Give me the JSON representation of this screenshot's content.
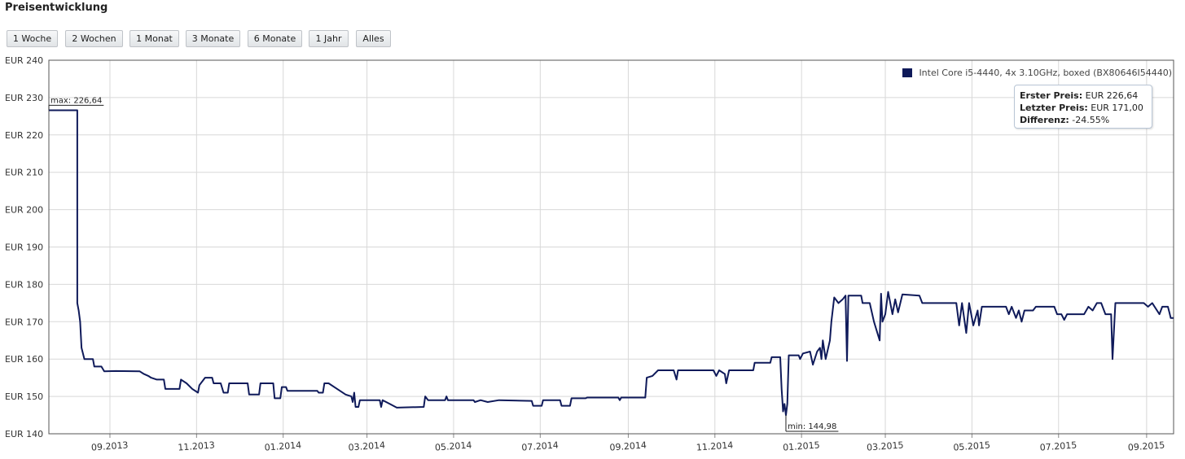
{
  "title": "Preisentwicklung",
  "range_buttons": [
    "1 Woche",
    "2 Wochen",
    "1 Monat",
    "3 Monate",
    "6 Monate",
    "1 Jahr",
    "Alles"
  ],
  "legend": {
    "label": "Intel Core i5-4440, 4x 3.10GHz, boxed (BX80646I54440)",
    "color": "#0f1a5a"
  },
  "stats": {
    "first_label": "Erster Preis:",
    "first_value": "EUR 226,64",
    "last_label": "Letzter Preis:",
    "last_value": "EUR 171,00",
    "diff_label": "Differenz:",
    "diff_value": "-24.55%"
  },
  "chart_data": {
    "type": "line",
    "x_start": "2013-07-20",
    "x_end": "2015-09-20",
    "ylim": [
      140,
      240
    ],
    "y_ticks": [
      140,
      150,
      160,
      170,
      180,
      190,
      200,
      210,
      220,
      230,
      240
    ],
    "y_tick_prefix": "EUR",
    "x_ticks": [
      "09.2013",
      "11.2013",
      "01.2014",
      "03.2014",
      "05.2014",
      "07.2014",
      "09.2014",
      "11.2014",
      "01.2015",
      "03.2015",
      "05.2015",
      "07.2015",
      "09.2015"
    ],
    "grid": true,
    "legend_position": "top-right",
    "annotations": [
      {
        "text": "max: 226,64",
        "x": "2013-07-20",
        "y": 226.64
      },
      {
        "text": "min: 144,98",
        "x": "2014-12-21",
        "y": 144.98
      }
    ],
    "series": [
      {
        "name": "Intel Core i5-4440, 4x 3.10GHz, boxed (BX80646I54440)",
        "color": "#0f1a5a",
        "points": [
          [
            "2013-07-20",
            226.6
          ],
          [
            "2013-08-09",
            226.6
          ],
          [
            "2013-08-09",
            175
          ],
          [
            "2013-08-10",
            173
          ],
          [
            "2013-08-11",
            170
          ],
          [
            "2013-08-12",
            163
          ],
          [
            "2013-08-14",
            160
          ],
          [
            "2013-08-20",
            160
          ],
          [
            "2013-08-21",
            158
          ],
          [
            "2013-08-26",
            158
          ],
          [
            "2013-08-28",
            156.7
          ],
          [
            "2013-09-05",
            156.8
          ],
          [
            "2013-09-22",
            156.7
          ],
          [
            "2013-09-25",
            156
          ],
          [
            "2013-09-28",
            155.5
          ],
          [
            "2013-09-30",
            155
          ],
          [
            "2013-10-04",
            154.5
          ],
          [
            "2013-10-09",
            154.5
          ],
          [
            "2013-10-10",
            152
          ],
          [
            "2013-10-20",
            152
          ],
          [
            "2013-10-21",
            154.5
          ],
          [
            "2013-10-25",
            153.5
          ],
          [
            "2013-10-29",
            152
          ],
          [
            "2013-11-02",
            151
          ],
          [
            "2013-11-03",
            153
          ],
          [
            "2013-11-07",
            155
          ],
          [
            "2013-11-12",
            155
          ],
          [
            "2013-11-13",
            153.5
          ],
          [
            "2013-11-18",
            153.5
          ],
          [
            "2013-11-20",
            151
          ],
          [
            "2013-11-23",
            151
          ],
          [
            "2013-11-24",
            153.5
          ],
          [
            "2013-12-07",
            153.5
          ],
          [
            "2013-12-08",
            150.5
          ],
          [
            "2013-12-15",
            150.5
          ],
          [
            "2013-12-16",
            153.5
          ],
          [
            "2013-12-25",
            153.5
          ],
          [
            "2013-12-26",
            149.5
          ],
          [
            "2013-12-30",
            149.5
          ],
          [
            "2013-12-31",
            152.5
          ],
          [
            "2014-01-03",
            152.5
          ],
          [
            "2014-01-04",
            151.5
          ],
          [
            "2014-01-25",
            151.5
          ],
          [
            "2014-01-26",
            151
          ],
          [
            "2014-01-29",
            151
          ],
          [
            "2014-01-30",
            153.5
          ],
          [
            "2014-02-02",
            153.5
          ],
          [
            "2014-02-08",
            152
          ],
          [
            "2014-02-14",
            150.5
          ],
          [
            "2014-02-18",
            150
          ],
          [
            "2014-02-19",
            148.5
          ],
          [
            "2014-02-20",
            151
          ],
          [
            "2014-02-21",
            147.2
          ],
          [
            "2014-02-23",
            147.2
          ],
          [
            "2014-02-24",
            149
          ],
          [
            "2014-03-10",
            149
          ],
          [
            "2014-03-11",
            147.2
          ],
          [
            "2014-03-12",
            149
          ],
          [
            "2014-03-17",
            148
          ],
          [
            "2014-03-22",
            147
          ],
          [
            "2014-04-10",
            147.2
          ],
          [
            "2014-04-11",
            150
          ],
          [
            "2014-04-13",
            149
          ],
          [
            "2014-04-25",
            149
          ],
          [
            "2014-04-26",
            150
          ],
          [
            "2014-04-27",
            149
          ],
          [
            "2014-05-15",
            149
          ],
          [
            "2014-05-16",
            148.5
          ],
          [
            "2014-05-20",
            149
          ],
          [
            "2014-05-25",
            148.5
          ],
          [
            "2014-06-02",
            149
          ],
          [
            "2014-06-25",
            148.8
          ],
          [
            "2014-06-26",
            147.5
          ],
          [
            "2014-07-02",
            147.5
          ],
          [
            "2014-07-03",
            149
          ],
          [
            "2014-07-15",
            149
          ],
          [
            "2014-07-16",
            147.5
          ],
          [
            "2014-07-22",
            147.5
          ],
          [
            "2014-07-23",
            149.5
          ],
          [
            "2014-08-02",
            149.5
          ],
          [
            "2014-08-03",
            149.7
          ],
          [
            "2014-08-25",
            149.7
          ],
          [
            "2014-08-26",
            149
          ],
          [
            "2014-08-27",
            149.7
          ],
          [
            "2014-09-13",
            149.7
          ],
          [
            "2014-09-14",
            155
          ],
          [
            "2014-09-18",
            155.5
          ],
          [
            "2014-09-22",
            157
          ],
          [
            "2014-10-03",
            157
          ],
          [
            "2014-10-05",
            154.5
          ],
          [
            "2014-10-06",
            157
          ],
          [
            "2014-10-31",
            157
          ],
          [
            "2014-11-02",
            155.5
          ],
          [
            "2014-11-04",
            157
          ],
          [
            "2014-11-08",
            156
          ],
          [
            "2014-11-09",
            153.5
          ],
          [
            "2014-11-11",
            157
          ],
          [
            "2014-11-28",
            157
          ],
          [
            "2014-11-29",
            159
          ],
          [
            "2014-12-10",
            159
          ],
          [
            "2014-12-11",
            160.5
          ],
          [
            "2014-12-17",
            160.5
          ],
          [
            "2014-12-18",
            152
          ],
          [
            "2014-12-19",
            146
          ],
          [
            "2014-12-20",
            148
          ],
          [
            "2014-12-21",
            144.98
          ],
          [
            "2014-12-22",
            148
          ],
          [
            "2014-12-23",
            161
          ],
          [
            "2014-12-30",
            161
          ],
          [
            "2014-12-31",
            160
          ],
          [
            "2015-01-02",
            161.5
          ],
          [
            "2015-01-07",
            162
          ],
          [
            "2015-01-09",
            158.5
          ],
          [
            "2015-01-12",
            162
          ],
          [
            "2015-01-14",
            163
          ],
          [
            "2015-01-15",
            160
          ],
          [
            "2015-01-16",
            165
          ],
          [
            "2015-01-18",
            160
          ],
          [
            "2015-01-21",
            165
          ],
          [
            "2015-01-22",
            170
          ],
          [
            "2015-01-24",
            176.5
          ],
          [
            "2015-01-27",
            175
          ],
          [
            "2015-01-30",
            176
          ],
          [
            "2015-02-01",
            177
          ],
          [
            "2015-02-02",
            159.5
          ],
          [
            "2015-02-03",
            177
          ],
          [
            "2015-02-12",
            177
          ],
          [
            "2015-02-13",
            175
          ],
          [
            "2015-02-18",
            175
          ],
          [
            "2015-02-21",
            170
          ],
          [
            "2015-02-25",
            165
          ],
          [
            "2015-02-26",
            177.5
          ],
          [
            "2015-02-27",
            170
          ],
          [
            "2015-03-01",
            172
          ],
          [
            "2015-03-03",
            178
          ],
          [
            "2015-03-06",
            172
          ],
          [
            "2015-03-08",
            176
          ],
          [
            "2015-03-10",
            172.5
          ],
          [
            "2015-03-13",
            177.3
          ],
          [
            "2015-03-25",
            177
          ],
          [
            "2015-03-27",
            175
          ],
          [
            "2015-04-20",
            175
          ],
          [
            "2015-04-22",
            169
          ],
          [
            "2015-04-24",
            175
          ],
          [
            "2015-04-27",
            167
          ],
          [
            "2015-04-29",
            175
          ],
          [
            "2015-05-02",
            169
          ],
          [
            "2015-05-05",
            173
          ],
          [
            "2015-05-06",
            169
          ],
          [
            "2015-05-08",
            174
          ],
          [
            "2015-05-25",
            174
          ],
          [
            "2015-05-27",
            172
          ],
          [
            "2015-05-29",
            174
          ],
          [
            "2015-06-01",
            171
          ],
          [
            "2015-06-03",
            173
          ],
          [
            "2015-06-05",
            170
          ],
          [
            "2015-06-07",
            173
          ],
          [
            "2015-06-13",
            173
          ],
          [
            "2015-06-15",
            174
          ],
          [
            "2015-06-28",
            174
          ],
          [
            "2015-06-30",
            172
          ],
          [
            "2015-07-03",
            172
          ],
          [
            "2015-07-05",
            170.5
          ],
          [
            "2015-07-07",
            172
          ],
          [
            "2015-07-19",
            172
          ],
          [
            "2015-07-22",
            174
          ],
          [
            "2015-07-25",
            173
          ],
          [
            "2015-07-28",
            175
          ],
          [
            "2015-07-31",
            175
          ],
          [
            "2015-08-03",
            172
          ],
          [
            "2015-08-07",
            172
          ],
          [
            "2015-08-08",
            160
          ],
          [
            "2015-08-10",
            175
          ],
          [
            "2015-08-30",
            175
          ],
          [
            "2015-09-02",
            174
          ],
          [
            "2015-09-05",
            175
          ],
          [
            "2015-09-10",
            172
          ],
          [
            "2015-09-12",
            174
          ],
          [
            "2015-09-16",
            174
          ],
          [
            "2015-09-17",
            172.5
          ],
          [
            "2015-09-18",
            171
          ],
          [
            "2015-09-20",
            171
          ]
        ]
      }
    ]
  }
}
